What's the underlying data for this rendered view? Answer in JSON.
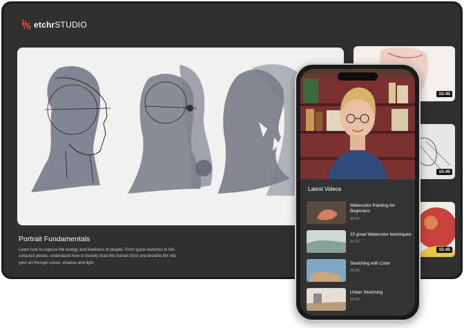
{
  "brand": {
    "name_bold": "etchr",
    "name_light": "STUDIO",
    "accent": "#e0522f"
  },
  "hero": {
    "title": "Portrait Fundamentals",
    "description": "Learn how to capture the energy and liveliness of people. From quick sketches to full-coloured pieces, understand how to loosely draw the human form and breathe life into your art through colour, shadow and light."
  },
  "side_thumbnails": [
    {
      "duration": "15:45"
    },
    {
      "duration": "15:45"
    },
    {
      "duration": "15:45"
    }
  ],
  "phone": {
    "latest_heading": "Latest Videos",
    "videos": [
      {
        "title": "Watercolor Painting for Beginners",
        "duration": "40:07"
      },
      {
        "title": "10 great Watercolor techniques",
        "duration": "31:07"
      },
      {
        "title": "Sketching with Color",
        "duration": "20:05"
      },
      {
        "title": "Urban Sketching",
        "duration": "23:09"
      }
    ]
  }
}
